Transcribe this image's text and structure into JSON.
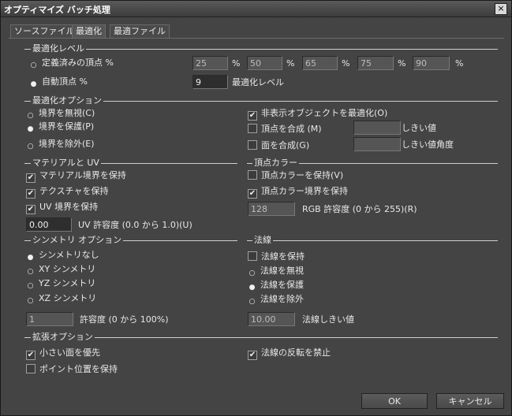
{
  "window": {
    "title": "オプティマイズ バッチ処理",
    "close_glyph": "×"
  },
  "tabs": [
    "ソースファイル",
    "最適化",
    "最適ファイル"
  ],
  "opt_level": {
    "section": "最適化レベル",
    "predefined_label": "定義済みの頂点 %",
    "predefined_values": [
      "25",
      "50",
      "65",
      "75",
      "90"
    ],
    "pct": "%",
    "auto_label": "自動頂点 %",
    "auto_value": "9",
    "auto_level_label": "最適化レベル"
  },
  "opt_options": {
    "section": "最適化オプション",
    "ignore_boundary": "境界を無視(C)",
    "protect_boundary": "境界を保護(P)",
    "exclude_boundary": "境界を除外(E)",
    "optimize_hidden": "非表示オブジェクトを最適化(O)",
    "merge_vertices": "頂点を合成 (M)",
    "threshold": "しきい値",
    "merge_faces": "面を合成(G)",
    "threshold_angle": "しきい値角度"
  },
  "material_uv": {
    "section": "マテリアルと UV",
    "keep_material_boundary": "マテリアル境界を保持",
    "keep_texture": "テクスチャを保持",
    "keep_uv_boundary": "UV 境界を保持",
    "uv_tolerance_value": "0.00",
    "uv_tolerance_label": "UV 許容度 (0.0 から 1.0)(U)"
  },
  "vertex_color": {
    "section": "頂点カラー",
    "keep_color": "頂点カラーを保持(V)",
    "keep_color_boundary": "頂点カラー境界を保持",
    "rgb_value": "128",
    "rgb_label": "RGB 許容度 (0 から 255)(R)"
  },
  "symmetry": {
    "section": "シンメトリ オプション",
    "none": "シンメトリなし",
    "xy": "XY シンメトリ",
    "yz": "YZ シンメトリ",
    "xz": "XZ シンメトリ",
    "tolerance_value": "1",
    "tolerance_label": "許容度 (0 から 100%)"
  },
  "normals": {
    "section": "法線",
    "keep": "法線を保持",
    "ignore": "法線を無視",
    "protect": "法線を保護",
    "exclude": "法線を除外",
    "threshold_value": "10.00",
    "threshold_label": "法線しきい値"
  },
  "extended": {
    "section": "拡張オプション",
    "prefer_small_faces": "小さい面を優先",
    "keep_point_positions": "ポイント位置を保持",
    "prevent_normal_flip": "法線の反転を禁止"
  },
  "buttons": {
    "ok": "OK",
    "cancel": "キャンセル"
  },
  "colors": {
    "background": "#444444",
    "field_disabled": "#555555",
    "field_active": "#2e2e2e",
    "text": "#e8e8e8"
  }
}
